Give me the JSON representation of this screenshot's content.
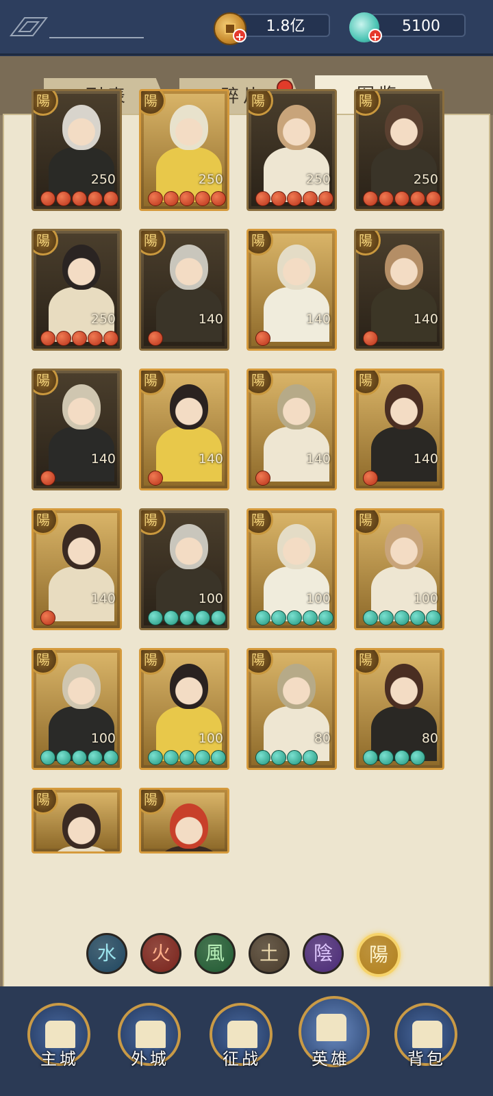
{
  "header": {
    "currency": {
      "icon": "copper-coin-icon",
      "value": "1.8亿"
    },
    "gems": {
      "icon": "jade-icon",
      "value": "5100"
    }
  },
  "tabs": [
    {
      "label": "列表",
      "active": false
    },
    {
      "label": "碎片",
      "active": false,
      "notification": true
    },
    {
      "label": "图鉴",
      "active": true
    }
  ],
  "cards": [
    {
      "badge": "陽",
      "level": "250",
      "stars": 5,
      "star_type": "red",
      "frame": "dark"
    },
    {
      "badge": "陽",
      "level": "250",
      "stars": 5,
      "star_type": "red",
      "frame": "gold"
    },
    {
      "badge": "陽",
      "level": "250",
      "stars": 5,
      "star_type": "red",
      "frame": "dark"
    },
    {
      "badge": "陽",
      "level": "250",
      "stars": 5,
      "star_type": "red",
      "frame": "dark"
    },
    {
      "badge": "陽",
      "level": "250",
      "stars": 5,
      "star_type": "red",
      "frame": "dark"
    },
    {
      "badge": "陽",
      "level": "140",
      "stars": 1,
      "star_type": "red",
      "frame": "dark"
    },
    {
      "badge": "陽",
      "level": "140",
      "stars": 1,
      "star_type": "red",
      "frame": "gold"
    },
    {
      "badge": "陽",
      "level": "140",
      "stars": 1,
      "star_type": "red",
      "frame": "dark"
    },
    {
      "badge": "陽",
      "level": "140",
      "stars": 1,
      "star_type": "red",
      "frame": "dark"
    },
    {
      "badge": "陽",
      "level": "140",
      "stars": 1,
      "star_type": "red",
      "frame": "gold"
    },
    {
      "badge": "陽",
      "level": "140",
      "stars": 1,
      "star_type": "red",
      "frame": "gold"
    },
    {
      "badge": "陽",
      "level": "140",
      "stars": 1,
      "star_type": "red",
      "frame": "gold"
    },
    {
      "badge": "陽",
      "level": "140",
      "stars": 1,
      "star_type": "red",
      "frame": "gold"
    },
    {
      "badge": "陽",
      "level": "100",
      "stars": 5,
      "star_type": "teal",
      "frame": "dark"
    },
    {
      "badge": "陽",
      "level": "100",
      "stars": 5,
      "star_type": "teal",
      "frame": "gold"
    },
    {
      "badge": "陽",
      "level": "100",
      "stars": 5,
      "star_type": "teal",
      "frame": "gold"
    },
    {
      "badge": "陽",
      "level": "100",
      "stars": 5,
      "star_type": "teal",
      "frame": "gold"
    },
    {
      "badge": "陽",
      "level": "100",
      "stars": 5,
      "star_type": "teal",
      "frame": "gold"
    },
    {
      "badge": "陽",
      "level": "80",
      "stars": 4,
      "star_type": "teal",
      "frame": "gold"
    },
    {
      "badge": "陽",
      "level": "80",
      "stars": 4,
      "star_type": "teal",
      "frame": "gold"
    },
    {
      "badge": "陽",
      "level": "",
      "stars": 0,
      "star_type": "teal",
      "frame": "gold"
    },
    {
      "badge": "陽",
      "level": "",
      "stars": 0,
      "star_type": "teal",
      "frame": "gold"
    }
  ],
  "elements": [
    {
      "label": "水",
      "color": "#1f4660",
      "fg": "#9be4ee"
    },
    {
      "label": "火",
      "color": "#7a231c",
      "fg": "#ffb08a"
    },
    {
      "label": "風",
      "color": "#1f5a32",
      "fg": "#b8f0b8"
    },
    {
      "label": "土",
      "color": "#4a3c2c",
      "fg": "#f2dfb2"
    },
    {
      "label": "陰",
      "color": "#4a2a78",
      "fg": "#e0c8ff"
    },
    {
      "label": "陽",
      "color": "#b2801c",
      "fg": "#fff6d0",
      "selected": true
    }
  ],
  "nav": [
    {
      "label": "主城",
      "icon": "main-city-icon"
    },
    {
      "label": "外城",
      "icon": "outer-city-icon"
    },
    {
      "label": "征战",
      "icon": "campaign-icon"
    },
    {
      "label": "英雄",
      "icon": "hero-icon",
      "active": true
    },
    {
      "label": "背包",
      "icon": "backpack-icon"
    }
  ]
}
